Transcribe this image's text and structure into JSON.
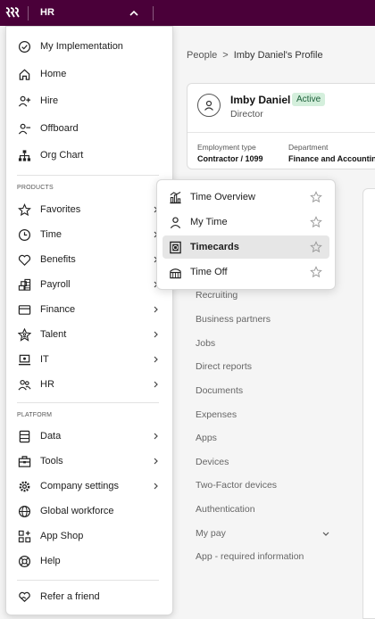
{
  "topbar": {
    "title": "HR",
    "color": "#4a0039"
  },
  "breadcrumb": {
    "root": "People",
    "separator": ">",
    "current": "Imby Daniel's Profile"
  },
  "profile": {
    "name": "Imby Daniel",
    "status": "Active",
    "role": "Director",
    "employment_type_label": "Employment type",
    "employment_type_value": "Contractor / 1099",
    "department_label": "Department",
    "department_value": "Finance and Accounting"
  },
  "background_nav": [
    "Recruiting",
    "Business partners",
    "Jobs",
    "Direct reports",
    "Documents",
    "Expenses",
    "Apps",
    "Devices",
    "Two-Factor devices",
    "Authentication",
    "My pay",
    "App - required information"
  ],
  "menu": {
    "top_items": [
      {
        "label": "My Implementation",
        "icon": "check-circle-icon"
      },
      {
        "label": "Home",
        "icon": "home-icon"
      },
      {
        "label": "Hire",
        "icon": "person-add-icon"
      },
      {
        "label": "Offboard",
        "icon": "person-remove-icon"
      },
      {
        "label": "Org Chart",
        "icon": "org-chart-icon"
      }
    ],
    "products_header": "PRODUCTS",
    "products": [
      {
        "label": "Favorites",
        "icon": "star-icon"
      },
      {
        "label": "Time",
        "icon": "clock-icon"
      },
      {
        "label": "Benefits",
        "icon": "heart-icon"
      },
      {
        "label": "Payroll",
        "icon": "coins-icon"
      },
      {
        "label": "Finance",
        "icon": "card-icon"
      },
      {
        "label": "Talent",
        "icon": "talent-star-icon"
      },
      {
        "label": "IT",
        "icon": "laptop-icon"
      },
      {
        "label": "HR",
        "icon": "people-icon"
      }
    ],
    "platform_header": "PLATFORM",
    "platform": [
      {
        "label": "Data",
        "icon": "database-icon",
        "chevron": true
      },
      {
        "label": "Tools",
        "icon": "toolbox-icon",
        "chevron": true
      },
      {
        "label": "Company settings",
        "icon": "gear-icon",
        "chevron": true
      },
      {
        "label": "Global workforce",
        "icon": "globe-icon",
        "chevron": false
      },
      {
        "label": "App Shop",
        "icon": "app-grid-icon",
        "chevron": false
      },
      {
        "label": "Help",
        "icon": "help-icon",
        "chevron": false
      }
    ],
    "refer": {
      "label": "Refer a friend",
      "icon": "heart-hands-icon"
    }
  },
  "submenu": {
    "items": [
      {
        "label": "Time Overview",
        "icon": "chart-icon"
      },
      {
        "label": "My Time",
        "icon": "person-icon"
      },
      {
        "label": "Timecards",
        "icon": "timecard-icon",
        "active": true
      },
      {
        "label": "Time Off",
        "icon": "calendar-icon"
      }
    ]
  }
}
